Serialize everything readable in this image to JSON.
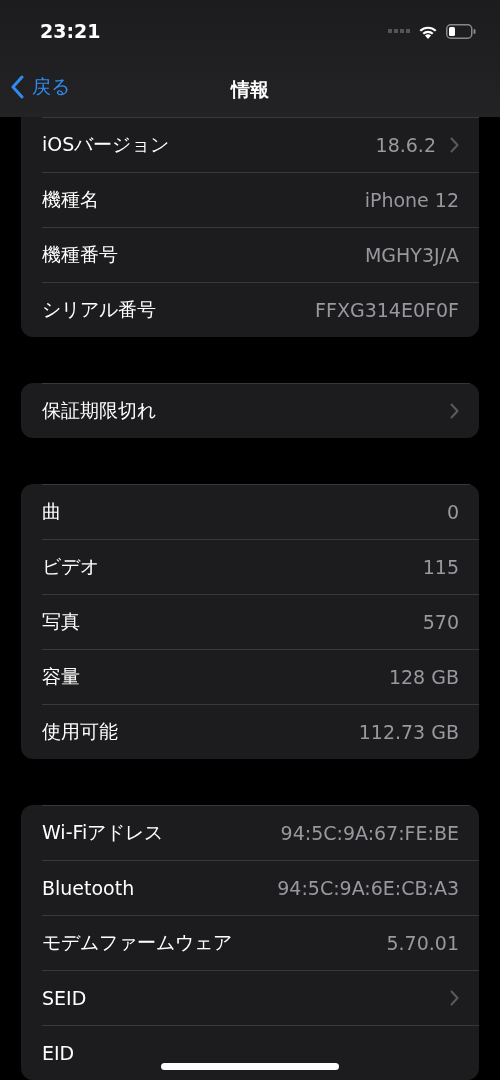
{
  "status_bar": {
    "time": "23:21"
  },
  "nav": {
    "back": "戻る",
    "title": "情報"
  },
  "groups": [
    {
      "rows": [
        {
          "label": "iOSバージョン",
          "value": "18.6.2",
          "chevron": true
        },
        {
          "label": "機種名",
          "value": "iPhone 12",
          "chevron": false
        },
        {
          "label": "機種番号",
          "value": "MGHY3J/A",
          "chevron": false
        },
        {
          "label": "シリアル番号",
          "value": "FFXG314E0F0F",
          "chevron": false
        }
      ]
    },
    {
      "rows": [
        {
          "label": "保証期限切れ",
          "chevron": true
        }
      ]
    },
    {
      "rows": [
        {
          "label": "曲",
          "value": "0",
          "chevron": false
        },
        {
          "label": "ビデオ",
          "value": "115",
          "chevron": false
        },
        {
          "label": "写真",
          "value": "570",
          "chevron": false
        },
        {
          "label": "容量",
          "value": "128 GB",
          "chevron": false
        },
        {
          "label": "使用可能",
          "value": "112.73 GB",
          "chevron": false
        }
      ]
    },
    {
      "rows": [
        {
          "label": "Wi-Fiアドレス",
          "value": "94:5C:9A:67:FE:BE",
          "chevron": false
        },
        {
          "label": "Bluetooth",
          "value": "94:5C:9A:6E:CB:A3",
          "chevron": false
        },
        {
          "label": "モデムファームウェア",
          "value": "5.70.01",
          "chevron": false
        },
        {
          "label": "SEID",
          "chevron": true
        },
        {
          "label": "EID",
          "chevron": false
        }
      ]
    }
  ]
}
